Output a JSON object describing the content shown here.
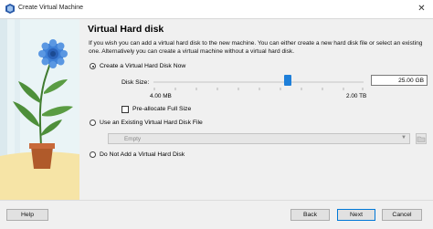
{
  "window": {
    "title": "Create Virtual Machine",
    "close_symbol": "✕"
  },
  "page": {
    "heading": "Virtual Hard disk",
    "description": "If you wish you can add a virtual hard disk to the new machine. You can either create a new hard disk file or select an existing one. Alternatively you can create a virtual machine without a virtual hard disk."
  },
  "options": {
    "create": {
      "label": "Create a Virtual Hard Disk Now",
      "selected": true
    },
    "existing": {
      "label": "Use an Existing Virtual Hard Disk File",
      "selected": false
    },
    "none": {
      "label": "Do Not Add a Virtual Hard Disk",
      "selected": false
    }
  },
  "disk_size": {
    "label": "Disk Size:",
    "value": "25.00 GB",
    "min_label": "4.00 MB",
    "max_label": "2.00 TB",
    "slider_fraction": 0.64
  },
  "preallocate": {
    "label": "Pre-allocate Full Size",
    "checked": false
  },
  "existing_file": {
    "value": "Empty"
  },
  "buttons": {
    "help": "Help",
    "back": "Back",
    "next": "Next",
    "cancel": "Cancel"
  },
  "colors": {
    "accent": "#1e7fd9",
    "panel_bg": "#eaf4f6",
    "flower": "#3d7fd6",
    "leaf": "#4e8f3a",
    "pot": "#b05a2a",
    "floor": "#f6e4a6"
  }
}
